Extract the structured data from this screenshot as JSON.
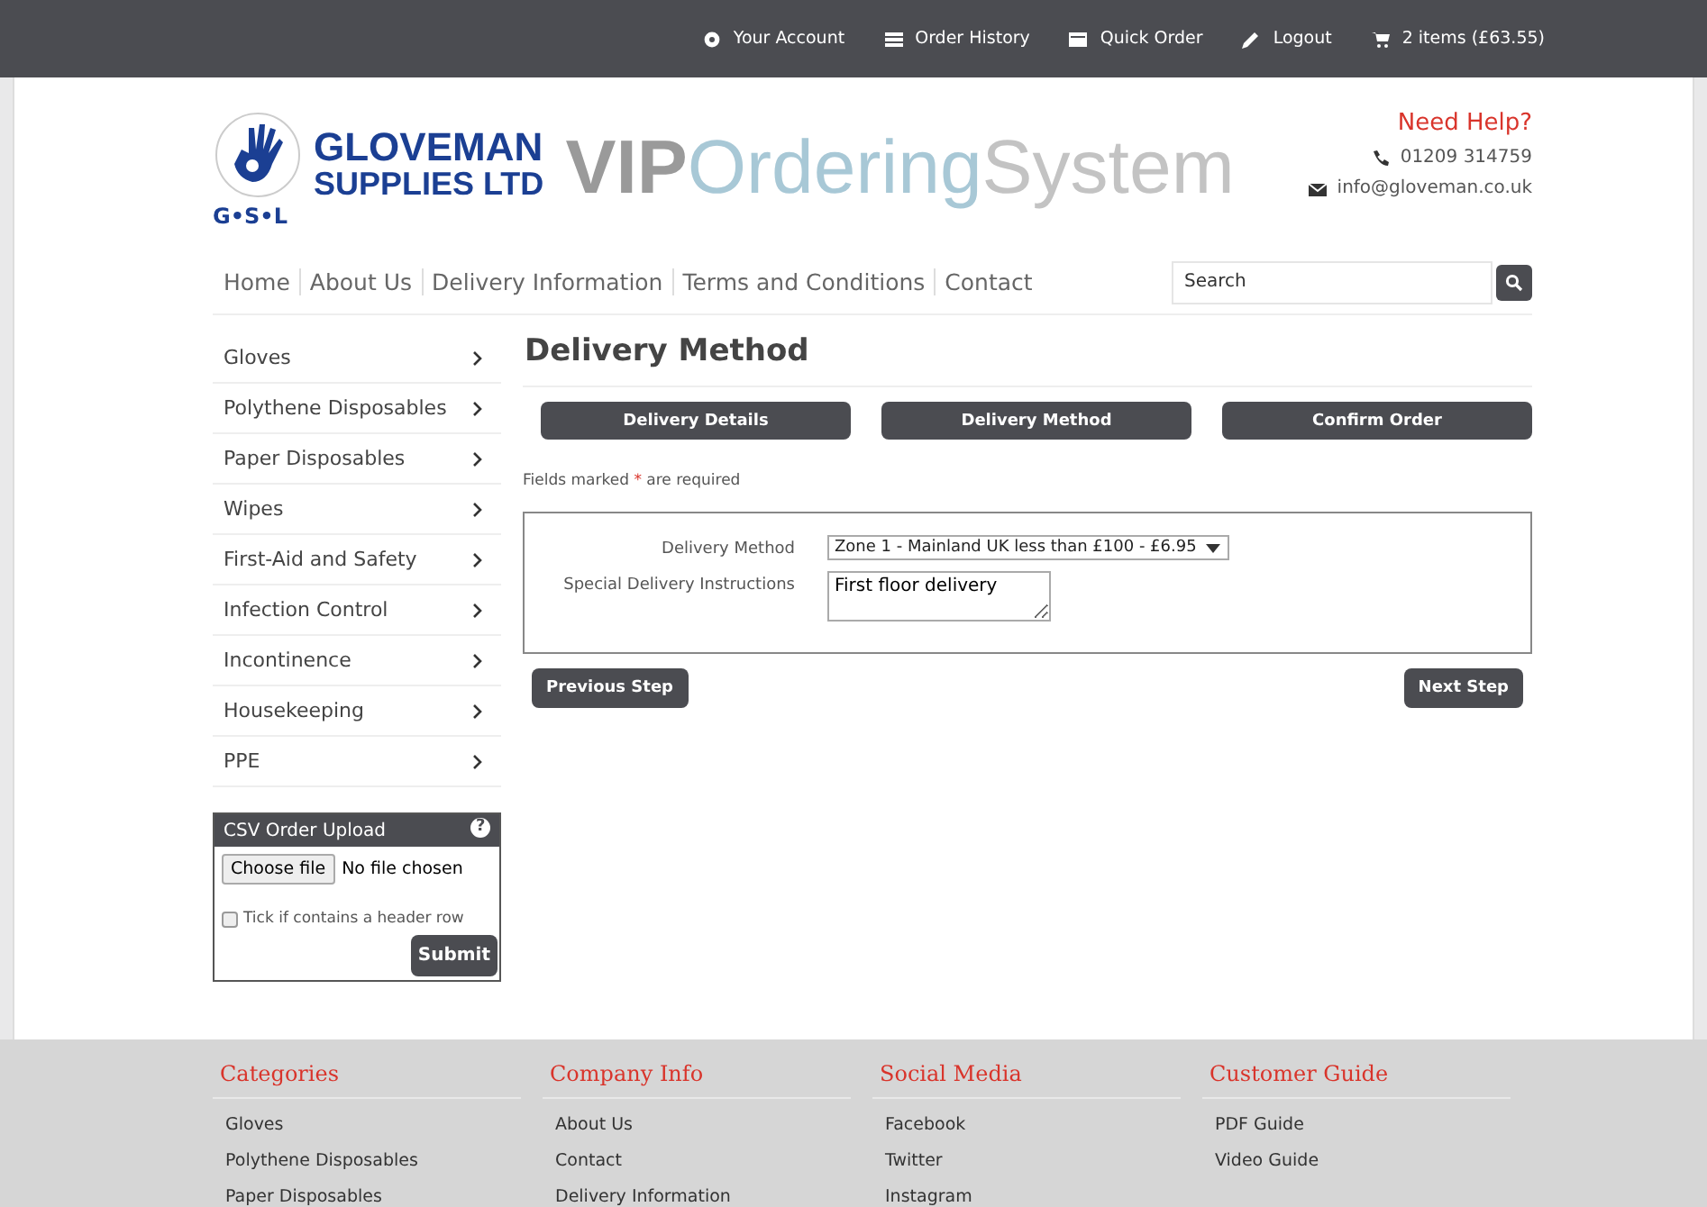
{
  "top_bar": {
    "links": [
      {
        "label": "Your Account"
      },
      {
        "label": "Order History"
      },
      {
        "label": "Quick Order"
      },
      {
        "label": "Logout"
      },
      {
        "label": "2 items (£63.55)"
      }
    ]
  },
  "header": {
    "logo": {
      "name_line_1": "GLOVEMAN",
      "name_line_2": "SUPPLIES LTD",
      "initials": "G•S•L"
    },
    "title": {
      "part_1": "VIP",
      "part_2": "Ordering",
      "part_3": "System"
    },
    "help": {
      "heading": "Need Help?",
      "phone": "01209 314759",
      "email": "info@gloveman.co.uk"
    }
  },
  "nav": {
    "items": [
      "Home",
      "About Us",
      "Delivery Information",
      "Terms and Conditions",
      "Contact"
    ],
    "search": {
      "placeholder": "Search"
    }
  },
  "sidebar": {
    "items": [
      "Gloves",
      "Polythene Disposables",
      "Paper Disposables",
      "Wipes",
      "First-Aid and Safety",
      "Infection Control",
      "Incontinence",
      "Housekeeping",
      "PPE"
    ],
    "csv_upload": {
      "title": "CSV Order Upload",
      "help": "?",
      "file_button": "Choose file",
      "file_status": "No file chosen",
      "header_row": {
        "label": "Tick if contains a header row",
        "checked": false
      },
      "submit": "Submit"
    }
  },
  "main": {
    "heading": "Delivery Method",
    "steps": [
      "Delivery Details",
      "Delivery Method",
      "Confirm Order"
    ],
    "required_note": {
      "before": "Fields marked",
      "mark": "*",
      "after": "are required"
    },
    "form": {
      "delivery_method": {
        "label": "Delivery Method",
        "value": "Zone 1 - Mainland UK less than £100 - £6.95"
      },
      "instructions": {
        "label": "Special Delivery Instructions",
        "value": "First floor delivery"
      }
    },
    "previous": "Previous Step",
    "next": "Next Step"
  },
  "footer": {
    "columns": [
      {
        "heading": "Categories",
        "links": [
          "Gloves",
          "Polythene Disposables",
          "Paper Disposables"
        ]
      },
      {
        "heading": "Company Info",
        "links": [
          "About Us",
          "Contact",
          "Delivery Information"
        ]
      },
      {
        "heading": "Social Media",
        "links": [
          "Facebook",
          "Twitter",
          "Instagram"
        ]
      },
      {
        "heading": "Customer Guide",
        "links": [
          "PDF Guide",
          "Video Guide"
        ]
      }
    ]
  }
}
